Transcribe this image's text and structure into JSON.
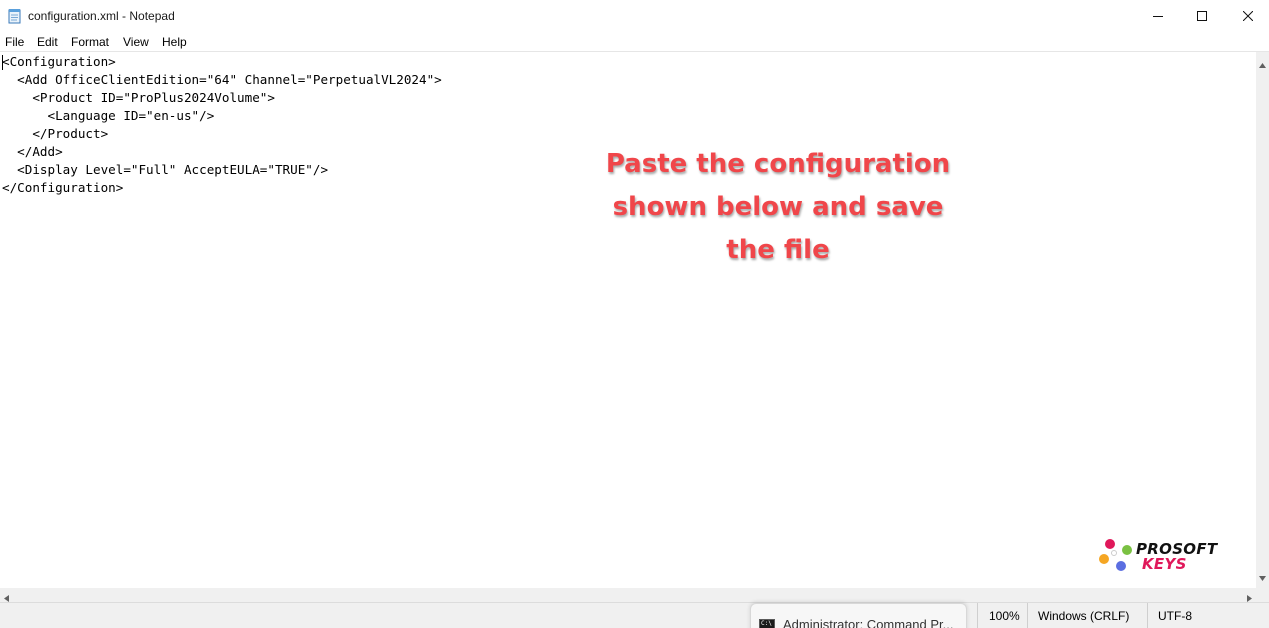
{
  "window": {
    "title": "configuration.xml - Notepad"
  },
  "menu": [
    "File",
    "Edit",
    "Format",
    "View",
    "Help"
  ],
  "editor": {
    "lines": [
      "<Configuration>",
      "  <Add OfficeClientEdition=\"64\" Channel=\"PerpetualVL2024\">",
      "    <Product ID=\"ProPlus2024Volume\">",
      "      <Language ID=\"en-us\"/>",
      "    </Product>",
      "  </Add>",
      "  <Display Level=\"Full\" AcceptEULA=\"TRUE\"/>",
      "</Configuration>"
    ]
  },
  "annotation": {
    "lines": [
      "Paste the configuration",
      "shown below and save",
      "the file"
    ],
    "color": "#f0464a"
  },
  "status": {
    "zoom": "100%",
    "line_ending": "Windows (CRLF)",
    "encoding": "UTF-8"
  },
  "taskbar_tooltip": {
    "icon_text": "C:\\",
    "label": "Administrator: Command Pr..."
  },
  "logo": {
    "line1": "PROSOFT",
    "line2": "KEYS",
    "colors": [
      "#e0185a",
      "#7ac142",
      "#f5a623",
      "#5b6ee1"
    ]
  },
  "icons": {
    "app": "notepad-icon",
    "minimize": "minimize-icon",
    "maximize": "maximize-icon",
    "close": "close-icon"
  }
}
